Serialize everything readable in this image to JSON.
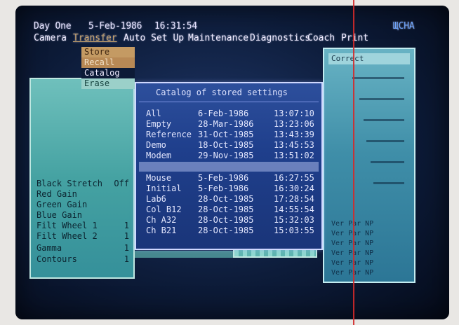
{
  "status": {
    "day": "Day One",
    "date": "5-Feb-1986",
    "time": "16:31:54",
    "right_label": "ЩСНА"
  },
  "menu": {
    "items": [
      "Camera",
      "Transfer",
      "Auto Set Up",
      "Maintenance",
      "Diagnostics",
      "Coach",
      "Print"
    ]
  },
  "transfer_menu": {
    "store": "Store",
    "recall": "Recall",
    "catalog": "Catalog",
    "erase": "Erase"
  },
  "left_panel": {
    "rows": [
      {
        "label": "Black Stretch",
        "value": "Off"
      },
      {
        "label": "Red   Gain",
        "value": ""
      },
      {
        "label": "Green Gain",
        "value": ""
      },
      {
        "label": "Blue  Gain",
        "value": ""
      },
      {
        "label": "Filt Wheel 1",
        "value": "1"
      },
      {
        "label": "Filt Wheel 2",
        "value": "1"
      },
      {
        "label": "Gamma",
        "value": "1"
      },
      {
        "label": "Contours",
        "value": "1"
      }
    ]
  },
  "catalog": {
    "title": "Catalog of stored settings",
    "entries": [
      {
        "name": "All",
        "date": "6-Feb-1986",
        "time": "13:07:10"
      },
      {
        "name": "Empty",
        "date": "28-Mar-1986",
        "time": "13:23:06"
      },
      {
        "name": "Reference",
        "date": "31-Oct-1985",
        "time": "13:43:39"
      },
      {
        "name": "Demo",
        "date": "18-Oct-1985",
        "time": "13:45:53"
      },
      {
        "name": "Modem",
        "date": "29-Nov-1985",
        "time": "13:51:02"
      },
      {
        "name": "Mouse",
        "date": "5-Feb-1986",
        "time": "16:27:55"
      },
      {
        "name": "Initial",
        "date": "5-Feb-1986",
        "time": "16:30:24"
      },
      {
        "name": "Lab6",
        "date": "28-Oct-1985",
        "time": "17:28:54"
      },
      {
        "name": "Col B12",
        "date": "28-Oct-1985",
        "time": "14:55:54"
      },
      {
        "name": "Ch A32",
        "date": "28-Oct-1985",
        "time": "15:32:03"
      },
      {
        "name": "Ch B21",
        "date": "28-Oct-1985",
        "time": "15:03:55"
      }
    ]
  },
  "right_panel": {
    "header": "Correct",
    "rows": [
      "Ver Par NP",
      "Ver Par NP",
      "Ver Par NP",
      "Ver Par NP",
      "Ver Par NP",
      "Ver Par NP"
    ]
  }
}
